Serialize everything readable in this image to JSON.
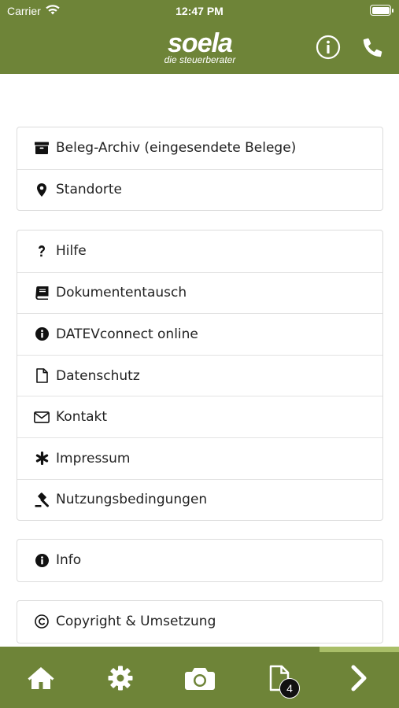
{
  "status_bar": {
    "carrier": "Carrier",
    "time": "12:47 PM"
  },
  "header": {
    "logo_main": "soela",
    "logo_sub": "die steuerberater",
    "icons": [
      "info-circle-icon",
      "phone-icon"
    ]
  },
  "groups": [
    {
      "items": [
        {
          "label": "Beleg-Archiv (eingesendete Belege)",
          "icon": "archive-icon"
        },
        {
          "label": "Standorte",
          "icon": "map-marker-icon"
        }
      ]
    },
    {
      "items": [
        {
          "label": "Hilfe",
          "icon": "question-icon"
        },
        {
          "label": "Dokumententausch",
          "icon": "book-icon"
        },
        {
          "label": "DATEVconnect online",
          "icon": "info-icon"
        },
        {
          "label": "Datenschutz",
          "icon": "file-icon"
        },
        {
          "label": "Kontakt",
          "icon": "envelope-icon"
        },
        {
          "label": "Impressum",
          "icon": "asterisk-icon"
        },
        {
          "label": "Nutzungsbedingungen",
          "icon": "gavel-icon"
        }
      ]
    },
    {
      "items": [
        {
          "label": "Info",
          "icon": "info-icon"
        }
      ]
    },
    {
      "items": [
        {
          "label": "Copyright & Umsetzung",
          "icon": "copyright-icon"
        }
      ]
    }
  ],
  "tabbar": {
    "items": [
      "home-icon",
      "settings-icon",
      "camera-icon",
      "document-icon",
      "chevron-right-icon"
    ],
    "document_badge": "4",
    "active_tab": "chevron-right"
  },
  "colors": {
    "brand": "#6e8438",
    "accent": "#a9be68"
  }
}
